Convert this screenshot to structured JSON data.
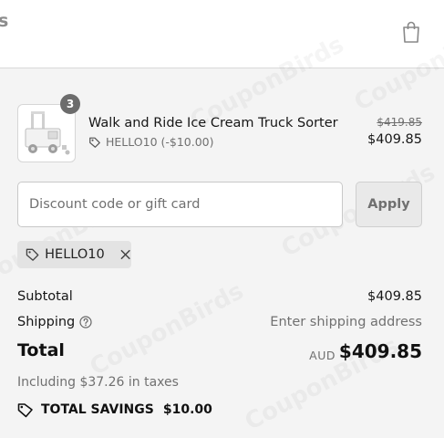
{
  "header": {
    "brand_fragment": "s",
    "cart_icon": "shopping-bag-icon"
  },
  "line_item": {
    "quantity": "3",
    "name": "Walk and Ride Ice Cream Truck Sorter",
    "discount_label": "HELLO10 (-$10.00)",
    "original_price": "$419.85",
    "price": "$409.85",
    "image_icon": "product-thumbnail"
  },
  "discount_form": {
    "placeholder": "Discount code or gift card",
    "value": "",
    "apply_label": "Apply"
  },
  "applied_code": {
    "code": "HELLO10",
    "tag_icon": "tag-icon",
    "remove_icon": "close-icon"
  },
  "totals": {
    "subtotal_label": "Subtotal",
    "subtotal_value": "$409.85",
    "shipping_label": "Shipping",
    "shipping_value": "Enter shipping address",
    "total_label": "Total",
    "currency": "AUD",
    "total_value": "$409.85",
    "taxes_text": "Including $37.26 in taxes",
    "savings_label": "TOTAL SAVINGS",
    "savings_value": "$10.00"
  },
  "watermark": "CouponBirds",
  "colors": {
    "background": "#f4f4f4",
    "header_background": "#ffffff",
    "muted_text": "#707070",
    "badge": "#6c6c6c",
    "chip_background": "#e3e3e3",
    "button_background": "#e9e9e9"
  }
}
